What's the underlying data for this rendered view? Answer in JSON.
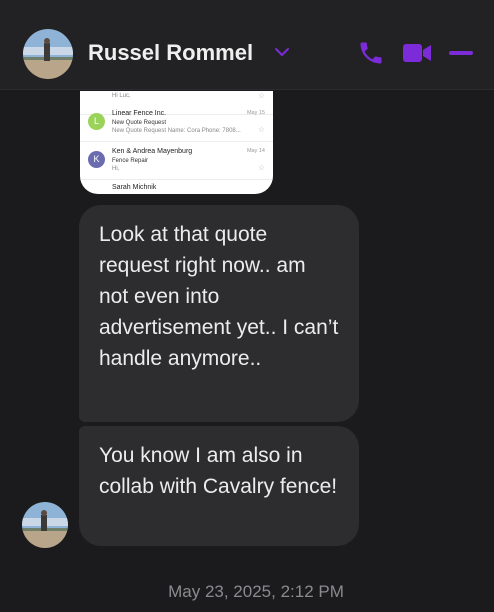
{
  "header": {
    "contact_name": "Russel Rommel",
    "icons": [
      "chevron-down-icon",
      "phone-icon",
      "video-icon",
      "minimize-icon"
    ],
    "accent_color": "#7b2bd8"
  },
  "attachment": {
    "type": "screenshot",
    "rows": [
      {
        "initial": "",
        "sender": "",
        "subject": "",
        "preview": "Hi Luc,",
        "date": "",
        "avatar_color": "#cccccc"
      },
      {
        "initial": "L",
        "sender": "Linear Fence Inc.",
        "subject": "New Quote Request",
        "preview": "New Quote Request Name: Cora Phone: 7808...",
        "date": "May 15",
        "avatar_color": "#9bd35a"
      },
      {
        "initial": "K",
        "sender": "Ken & Andrea Mayenburg",
        "subject": "Fence Repair",
        "preview": "Hi,",
        "date": "May 14",
        "avatar_color": "#6b6bb0"
      },
      {
        "initial": "",
        "sender": "Sarah Michnik",
        "subject": "",
        "preview": "",
        "date": "",
        "avatar_color": "#cccccc"
      }
    ]
  },
  "messages": [
    {
      "text": "Look at that quote request right now.. am not even into advertisement yet.. I can’t handle anymore.."
    },
    {
      "text": "You know I am also in collab with Cavalry fence!"
    }
  ],
  "timestamp": "May 23, 2025, 2:12 PM"
}
